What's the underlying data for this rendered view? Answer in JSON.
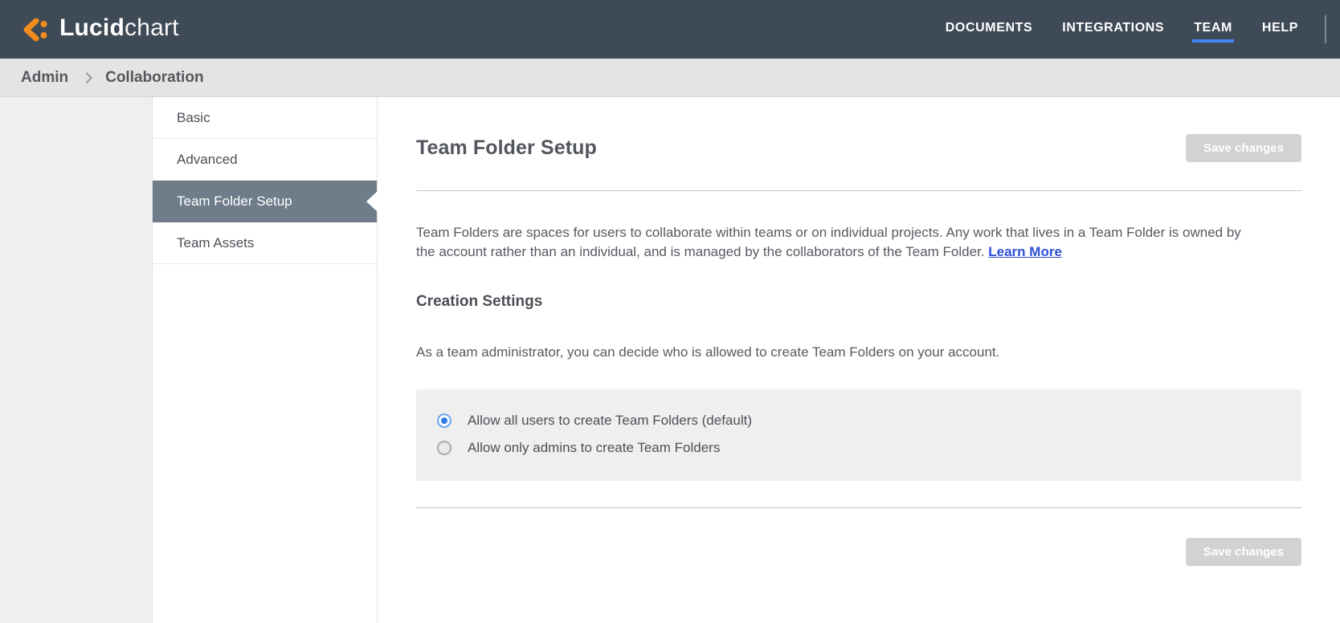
{
  "navbar": {
    "logo_bold": "Lucid",
    "logo_light": "chart",
    "items": [
      {
        "label": "DOCUMENTS",
        "active": false
      },
      {
        "label": "INTEGRATIONS",
        "active": false
      },
      {
        "label": "TEAM",
        "active": true
      },
      {
        "label": "HELP",
        "active": false
      }
    ]
  },
  "breadcrumb": {
    "items": [
      "Admin",
      "Collaboration"
    ]
  },
  "sidebar": {
    "items": [
      {
        "label": "Basic",
        "selected": false
      },
      {
        "label": "Advanced",
        "selected": false
      },
      {
        "label": "Team Folder Setup",
        "selected": true
      },
      {
        "label": "Team Assets",
        "selected": false
      }
    ]
  },
  "main": {
    "title": "Team Folder Setup",
    "save_button_label": "Save changes",
    "intro_text": "Team Folders are spaces for users to collaborate within teams or on individual projects. Any work that lives in a Team Folder is owned by the account rather than an individual, and is managed by the collaborators of the Team Folder.",
    "learn_more_label": "Learn More",
    "section": {
      "heading": "Creation Settings",
      "description": "As a team administrator, you can decide who is allowed to create Team Folders on your account.",
      "options": [
        {
          "label": "Allow all users to create Team Folders (default)",
          "selected": true
        },
        {
          "label": "Allow only admins to create Team Folders",
          "selected": false
        }
      ]
    }
  },
  "colors": {
    "navbar_bg": "#3e4a56",
    "brand_orange": "#f18d1c",
    "active_tab_underline": "#4285f4",
    "selected_menu_bg": "#6f7d8b",
    "link_blue": "#2c4fd8",
    "radio_selected_blue": "#2e7ee6",
    "disabled_button_bg": "#d2d2d2"
  }
}
